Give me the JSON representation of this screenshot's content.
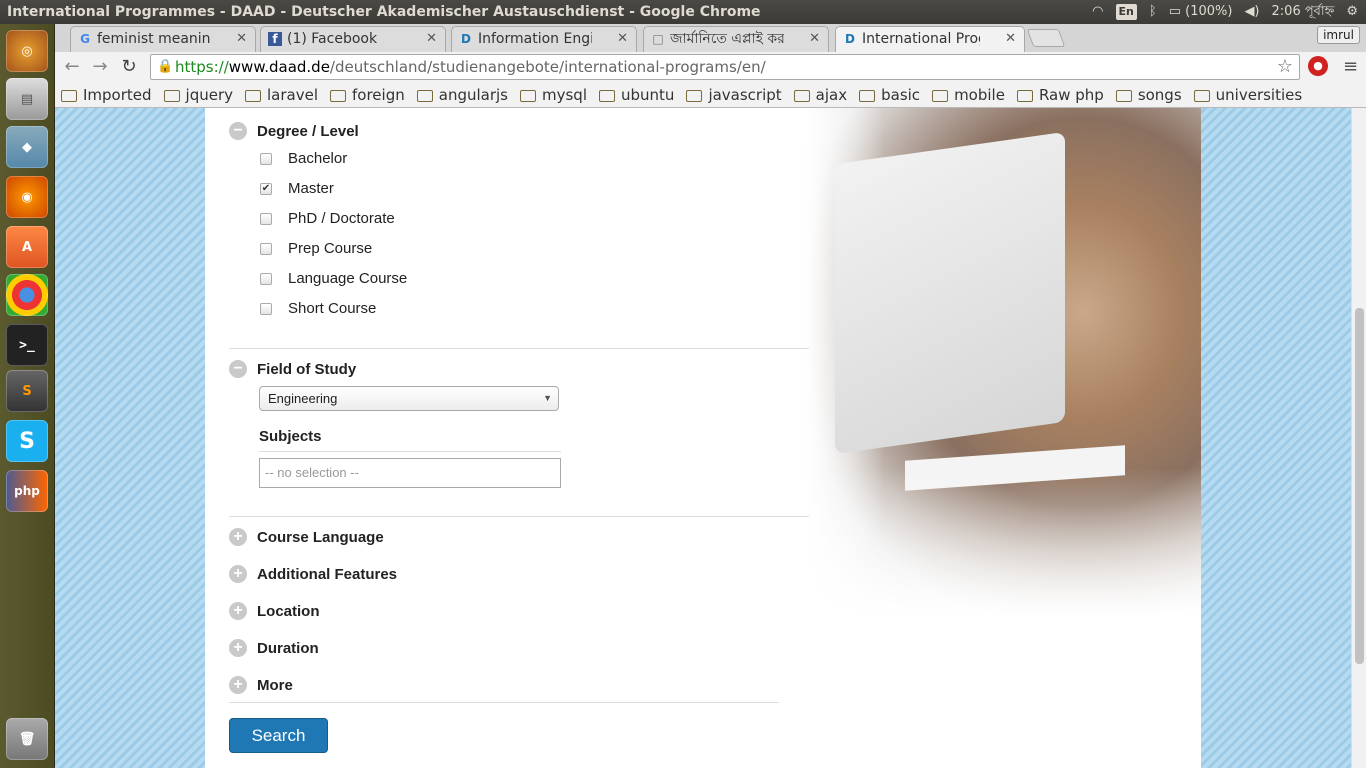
{
  "window_title": "International Programmes - DAAD - Deutscher Akademischer Austauschdienst - Google Chrome",
  "system_tray": {
    "keyboard": "En",
    "battery": "(100%)",
    "clock": "2:06 পূর্বাহ্ন"
  },
  "tabs": [
    {
      "icon": "G",
      "label": "feminist meaning in",
      "active": false
    },
    {
      "icon": "f",
      "label": "(1) Facebook",
      "active": false
    },
    {
      "icon": "D",
      "label": "Information Engine",
      "active": false
    },
    {
      "icon": "□",
      "label": "জার্মানিতে এপ্লাই করার ধাপ",
      "active": false
    },
    {
      "icon": "D",
      "label": "International Progra",
      "active": true
    }
  ],
  "profile_name": "imrul",
  "url": {
    "scheme": "https://",
    "host": "www.daad.de",
    "path": "/deutschland/studienangebote/international-programs/en/"
  },
  "bookmarks": [
    "Imported",
    "jquery",
    "laravel",
    "foreign",
    "angularjs",
    "mysql",
    "ubuntu",
    "javascript",
    "ajax",
    "basic",
    "mobile",
    "Raw php",
    "songs",
    "universities"
  ],
  "filters": {
    "degree": {
      "title": "Degree / Level",
      "options": [
        {
          "label": "Bachelor",
          "checked": false
        },
        {
          "label": "Master",
          "checked": true
        },
        {
          "label": "PhD / Doctorate",
          "checked": false
        },
        {
          "label": "Prep Course",
          "checked": false
        },
        {
          "label": "Language Course",
          "checked": false
        },
        {
          "label": "Short Course",
          "checked": false
        }
      ]
    },
    "field": {
      "title": "Field of Study",
      "selected": "Engineering",
      "subjects_label": "Subjects",
      "subjects_placeholder": "-- no selection --"
    },
    "collapsed": [
      "Course Language",
      "Additional Features",
      "Location",
      "Duration",
      "More"
    ]
  },
  "search_label": "Search"
}
